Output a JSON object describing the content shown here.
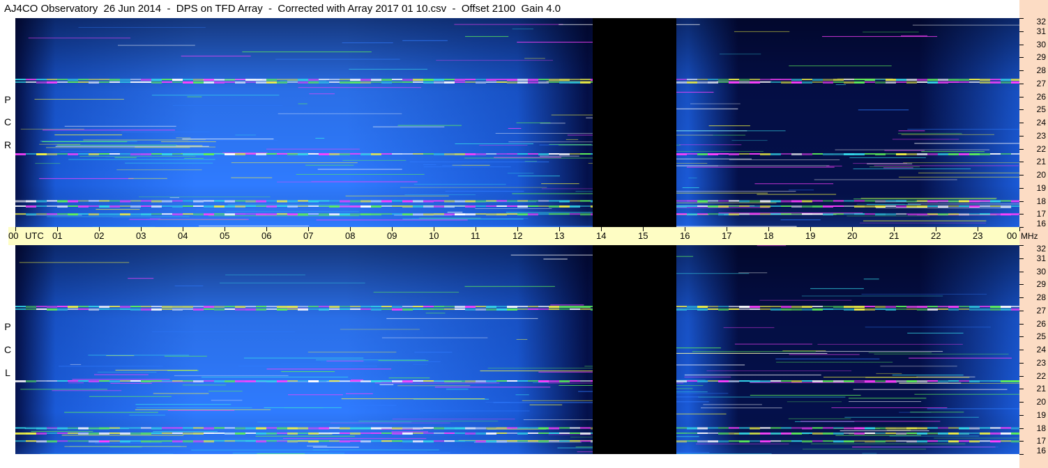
{
  "chart_data": {
    "type": "heatmap",
    "title": "AJ4CO Observatory  26 Jun 2014  -  DPS on TFD Array  -  Corrected with Array 2017 01 10.csv  -  Offset 2100  Gain 4.0",
    "x_unit": "UTC",
    "y_unit": "MHz",
    "xlim": [
      0,
      24
    ],
    "ylim": [
      16,
      32
    ],
    "x_ticks": [
      "00",
      "01",
      "02",
      "03",
      "04",
      "05",
      "06",
      "07",
      "08",
      "09",
      "10",
      "11",
      "12",
      "13",
      "14",
      "15",
      "16",
      "17",
      "18",
      "19",
      "20",
      "21",
      "22",
      "23",
      "00"
    ],
    "y_ticks": [
      "32",
      "31",
      "30",
      "29",
      "28",
      "27",
      "26",
      "25",
      "24",
      "23",
      "22",
      "21",
      "20",
      "19",
      "18",
      "17",
      "16"
    ],
    "panels": [
      {
        "name": "rcp",
        "letters": [
          "R",
          "C",
          "P"
        ]
      },
      {
        "name": "lcp",
        "letters": [
          "L",
          "C",
          "P"
        ]
      }
    ],
    "data_gap_utc": [
      13.8,
      15.8
    ],
    "strong_bands_mhz": [
      17.0,
      17.6,
      18.0,
      21.6,
      27.1,
      27.3
    ],
    "colors": {
      "background_low": "#04104a",
      "background_mid": "#1a5ad8",
      "background_high": "#2f7bff",
      "band_cyan": "#35d7e8",
      "band_green": "#5ef05a",
      "band_yellow": "#f2f244",
      "band_magenta": "#ff40ff",
      "band_white": "#ffffff",
      "gap": "#000000",
      "time_bar": "#fefdc4",
      "freq_bar": "#fcdcc4"
    }
  }
}
